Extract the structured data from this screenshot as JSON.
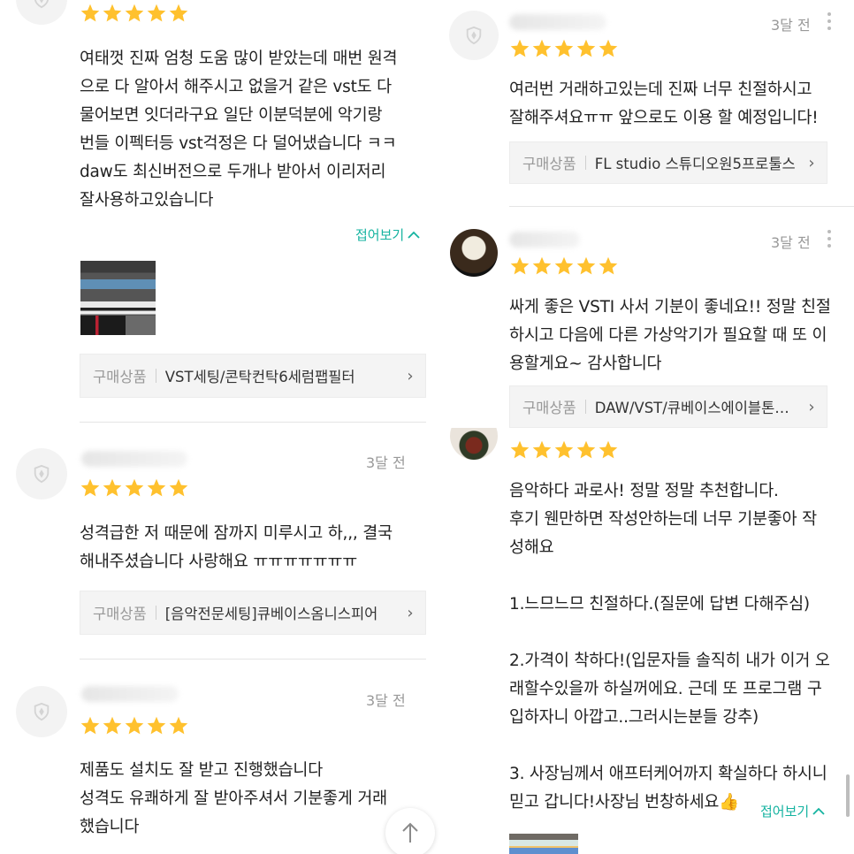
{
  "left_reviews": [
    {
      "rating": 5,
      "text": "여태껏 진짜 엄청 도움 많이 받았는데 매번 원격\n으로 다 알아서 해주시고 없을거 같은 vst도 다\n물어보면 잇더라구요 일단 이분덕분에 악기랑\n번들 이펙터등 vst걱정은 다 덜어냈습니다 ㅋㅋ\ndaw도 최신버전으로 두개나 받아서 이리저리\n잘사용하고있습니다",
      "collapse_label": "접어보기",
      "product_label": "구매상품",
      "product_name": "VST세팅/콘탁컨탁6세럼팹필터"
    },
    {
      "time": "3달 전",
      "rating": 5,
      "text": "성격급한 저 때문에 잠까지 미루시고 하,,, 결국\n해내주셨습니다 사랑해요 ㅠㅠㅠㅠㅠㅠㅠ",
      "product_label": "구매상품",
      "product_name": "[음악전문세팅]큐베이스옴니스피어"
    },
    {
      "time": "3달 전",
      "rating": 5,
      "text": "제품도 설치도 잘 받고 진행했습니다\n성격도 유쾌하게 잘 받아주셔서 기분좋게 거래\n했습니다"
    }
  ],
  "right_reviews": [
    {
      "time": "3달 전",
      "rating": 5,
      "text": "여러번 거래하고있는데 진짜 너무 친절하시고\n잘해주셔요ㅠㅠ 앞으로도 이용 할 예정입니다!",
      "product_label": "구매상품",
      "product_name": "FL studio 스튜디오원5프로툴스"
    },
    {
      "time": "3달 전",
      "rating": 5,
      "text": "싸게 좋은 VSTI 사서 기분이 좋네요!! 정말 친절\n하시고 다음에 다른 가상악기가 필요할 때 또 이\n용할게요~ 감사합니다",
      "product_label": "구매상품",
      "product_name": "DAW/VST/큐베이스에이블톤로직"
    },
    {
      "rating": 5,
      "text": "음악하다 과로사! 정말 정말 추천합니다.\n후기 웬만하면 작성안하는데 너무 기분좋아 작\n성해요\n\n1.느므느므 친절하다.(질문에 답변 다해주심)\n\n2.가격이 착하다!(입문자들 솔직히 내가 이거 오\n래할수있을까 하실꺼에요. 근데 또 프로그램 구\n입하자니 아깝고..그러시는분들 강추)\n\n3. 사장님께서 애프터케어까지 확실하다 하시니\n믿고 갑니다!사장님 번창하세요👍",
      "collapse_label": "접어보기"
    }
  ],
  "icons": {
    "star": "star-icon",
    "shield": "shield-icon",
    "chevron": "chevron-right-icon",
    "up": "arrow-up-icon",
    "more": "more-vertical-icon"
  },
  "colors": {
    "star": "#FFC12E",
    "accent": "#15B3A0"
  }
}
